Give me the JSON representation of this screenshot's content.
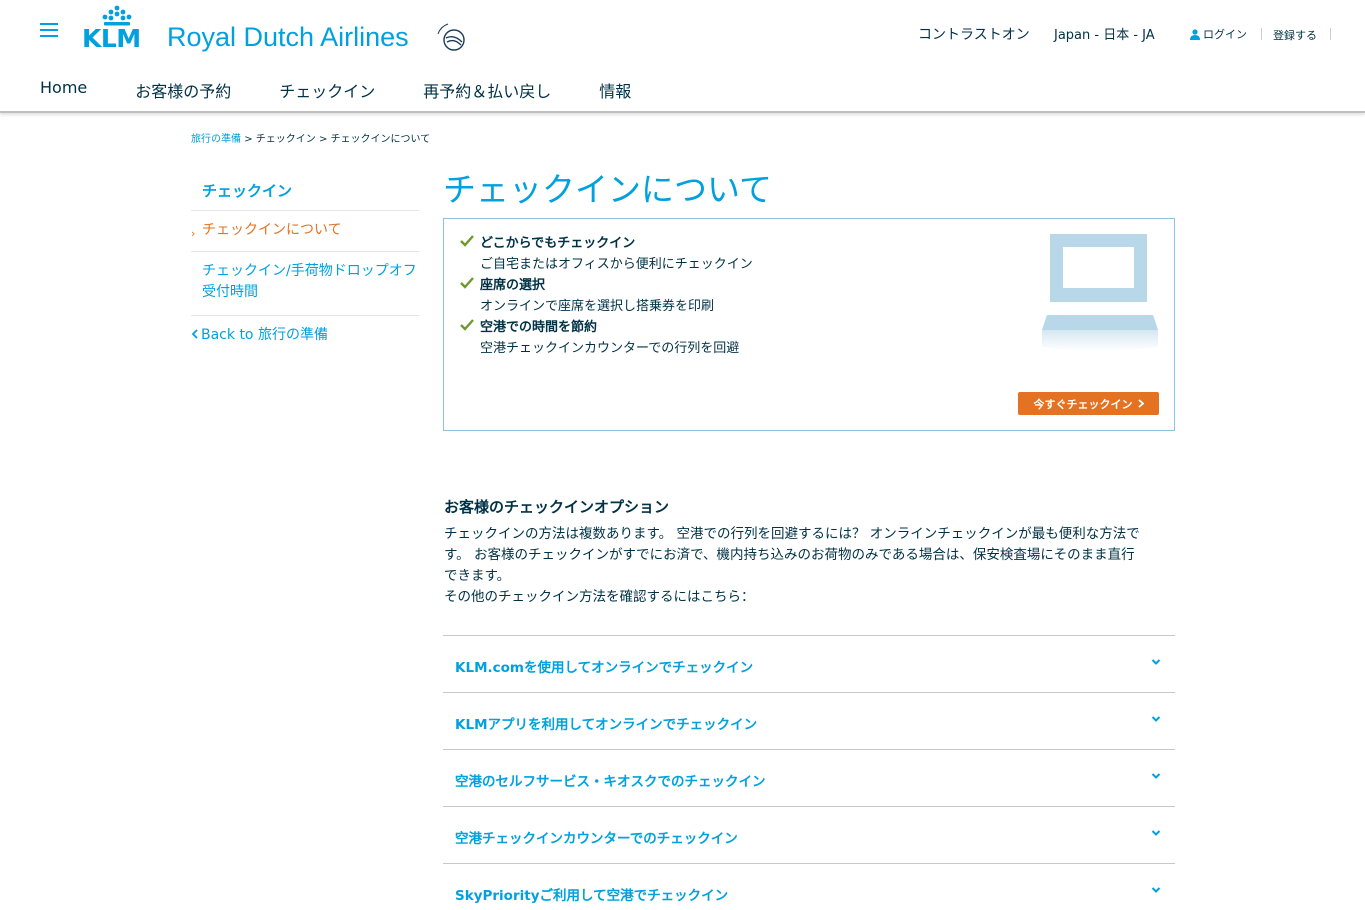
{
  "header": {
    "logo_klm": "KLM",
    "logo_name": "Royal Dutch Airlines",
    "contrast_label": "コントラストオン",
    "locale_label": "Japan - 日本 - JA",
    "login_label": "ログイン",
    "register_label": "登録する",
    "accent_color": "#00a1de"
  },
  "main_nav": [
    {
      "label": "Home"
    },
    {
      "label": "お客様の予約"
    },
    {
      "label": "チェックイン"
    },
    {
      "label": "再予約＆払い戻し"
    },
    {
      "label": "情報"
    }
  ],
  "breadcrumb": {
    "items": [
      "旅行の準備",
      "チェックイン",
      "チェックインについて"
    ],
    "separator": ">"
  },
  "sidebar": {
    "title": "チェックイン",
    "items": [
      {
        "label": "チェックインについて",
        "active": true
      },
      {
        "label_line1": "チェックイン/手荷物ドロップオフ",
        "label_line2": "受付時間",
        "active": false
      }
    ],
    "back_label": "Back to 旅行の準備"
  },
  "page": {
    "title": "チェックインについて"
  },
  "promo": {
    "features": [
      {
        "title": "どこからでもチェックイン",
        "desc": "ご自宅またはオフィスから便利にチェックイン"
      },
      {
        "title": "座席の選択",
        "desc": "オンラインで座席を選択し搭乗券を印刷"
      },
      {
        "title": "空港での時間を節約",
        "desc": "空港チェックインカウンターでの行列を回避"
      }
    ],
    "cta_label": "今すぐチェックイン",
    "cta_color": "#e37222"
  },
  "options": {
    "title": "お客様のチェックインオプション",
    "text_line1": "チェックインの方法は複数あります。 空港での行列を回避するには？ オンラインチェックインが最も便利な方法で",
    "text_line2": "す。 お客様のチェックインがすでにお済で、機内持ち込みのお荷物のみである場合は、保安検査場にそのまま直行",
    "text_line3": "できます。",
    "text_line4": "その他のチェックイン方法を確認するにはこちら：",
    "accordion": [
      {
        "label": "KLM.comを使用してオンラインでチェックイン"
      },
      {
        "label": "KLMアプリを利用してオンラインでチェックイン"
      },
      {
        "label": "空港のセルフサービス・キオスクでのチェックイン"
      },
      {
        "label": "空港チェックインカウンターでのチェックイン"
      },
      {
        "label": "SkyPriorityご利用して空港でチェックイン"
      }
    ]
  }
}
